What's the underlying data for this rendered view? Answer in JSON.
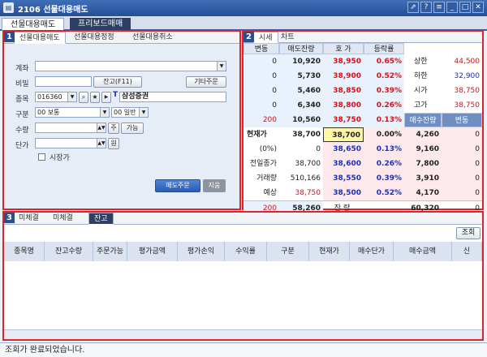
{
  "window": {
    "title": "2106 선물대용매도",
    "buttons": [
      "⇗",
      "?",
      "≡",
      "_",
      "□",
      "✕"
    ]
  },
  "top_tabs": [
    "선물대용매도",
    "프리보드매매"
  ],
  "order": {
    "tabs": [
      "선물대용매도",
      "선물대용정정",
      "선물대용취소"
    ],
    "labels": {
      "account": "계좌",
      "password": "비밀",
      "symbol": "종목",
      "type": "구분",
      "qty": "수량",
      "price": "단가",
      "market": "시장가"
    },
    "password_btn": "잔고(F11)",
    "other_btn": "기타주문",
    "code": "016360",
    "stock_name": "삼성증권",
    "type_value": "00 보통",
    "type_value2": "00 일반",
    "qty_unit": "주",
    "qty_btn": "가능",
    "price_unit": "원",
    "submit": "매도주문",
    "reset": "지움"
  },
  "quote": {
    "tabs": [
      "시세",
      "차트"
    ],
    "headers": [
      "변동",
      "매도잔량",
      "호 가",
      "등락률"
    ],
    "asks": [
      {
        "chg": "0",
        "qty": "10,920",
        "price": "38,950",
        "rate": "0.65%",
        "k": "상한",
        "v": "44,500"
      },
      {
        "chg": "0",
        "qty": "5,730",
        "price": "38,900",
        "rate": "0.52%",
        "k": "하한",
        "v": "32,900"
      },
      {
        "chg": "0",
        "qty": "5,460",
        "price": "38,850",
        "rate": "0.39%",
        "k": "시가",
        "v": "38,750"
      },
      {
        "chg": "0",
        "qty": "6,340",
        "price": "38,800",
        "rate": "0.26%",
        "k": "고가",
        "v": "38,750"
      },
      {
        "chg": "200",
        "qty": "10,560",
        "price": "38,750",
        "rate": "0.13%",
        "k": "저가",
        "v": "38,050"
      }
    ],
    "bid_headers": [
      "매수잔량",
      "변동"
    ],
    "bids": [
      {
        "k": "현재가",
        "v": "38,700",
        "price": "38,700",
        "rate": "0.00%",
        "qty": "4,260",
        "chg": "0"
      },
      {
        "k": "(0%)",
        "v": "0",
        "price": "38,650",
        "rate": "0.13%",
        "qty": "9,160",
        "chg": "0"
      },
      {
        "k": "전일종가",
        "v": "38,700",
        "price": "38,600",
        "rate": "0.26%",
        "qty": "7,800",
        "chg": "0"
      },
      {
        "k": "거래량",
        "v": "510,166",
        "price": "38,550",
        "rate": "0.39%",
        "qty": "3,910",
        "chg": "0"
      },
      {
        "k": "예상",
        "v": "38,750",
        "price": "38,500",
        "rate": "0.52%",
        "qty": "4,170",
        "chg": "0"
      }
    ],
    "total": {
      "chg": "200",
      "ask": "58,260",
      "label": "잔 량",
      "bid": "60,320",
      "bchg": "0"
    },
    "after": {
      "v": "0",
      "label": "시간외잔량",
      "bid": "904"
    }
  },
  "balance": {
    "tabs": [
      "미체결",
      "미체결",
      "잔고"
    ],
    "query_btn": "조회",
    "columns": [
      "종목명",
      "잔고수량",
      "주문가능",
      "평가금액",
      "평가손익",
      "수익률",
      "구분",
      "현재가",
      "매수단가",
      "매수금액",
      "신"
    ]
  },
  "status": "조회가 완료되었습니다."
}
